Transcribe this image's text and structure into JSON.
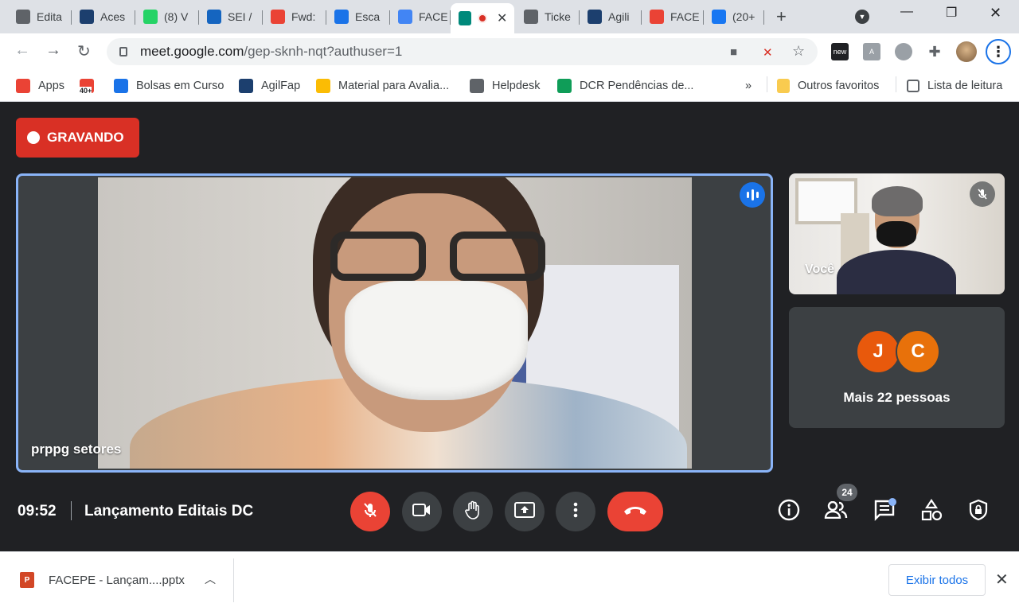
{
  "browser": {
    "tabs": [
      {
        "label": "Edita",
        "icon": "globe-icon",
        "color": "#5f6368"
      },
      {
        "label": "Aces",
        "icon": "app-icon",
        "color": "#1c3f6e"
      },
      {
        "label": "(8) V",
        "icon": "whatsapp-icon",
        "color": "#25d366"
      },
      {
        "label": "SEI /",
        "icon": "sei-icon",
        "color": "#1565c0"
      },
      {
        "label": "Fwd:",
        "icon": "gmail-icon",
        "color": "#ea4335"
      },
      {
        "label": "Esca",
        "icon": "app-icon",
        "color": "#1a73e8"
      },
      {
        "label": "FACE",
        "icon": "calendar-icon",
        "color": "#4285f4"
      },
      {
        "label": "Ticke",
        "icon": "globe-icon",
        "color": "#5f6368"
      },
      {
        "label": "Agili",
        "icon": "agilfap-icon",
        "color": "#1c3f6e"
      },
      {
        "label": "FACE",
        "icon": "app-icon",
        "color": "#ea4335"
      },
      {
        "label": "(20+",
        "icon": "facebook-icon",
        "color": "#1877f2"
      }
    ],
    "active_tab": {
      "icon": "meet-icon",
      "recording": true
    },
    "url_host": "meet.google.com",
    "url_path": "/gep-sknh-nqt?authuser=1",
    "bookmarks": [
      {
        "label": "Apps",
        "icon": "apps-grid-icon",
        "color": "#ea4335"
      },
      {
        "label": "",
        "icon": "gmail-icon",
        "color": "#ea4335",
        "badge": "40+"
      },
      {
        "label": "Bolsas em Curso",
        "icon": "app-icon",
        "color": "#1a73e8"
      },
      {
        "label": "AgilFap",
        "icon": "agilfap-icon",
        "color": "#1c3f6e"
      },
      {
        "label": "Material para Avalia...",
        "icon": "drive-icon",
        "color": "#fbbc04"
      },
      {
        "label": "Helpdesk",
        "icon": "globe-icon",
        "color": "#5f6368"
      },
      {
        "label": "DCR Pendências de...",
        "icon": "sheets-icon",
        "color": "#0f9d58"
      }
    ],
    "overflow": "»",
    "other_bookmarks": "Outros favoritos",
    "reading_list": "Lista de leitura"
  },
  "meet": {
    "recording_label": "GRAVANDO",
    "main_participant": "prppg setores",
    "self_label": "Você",
    "avatars": [
      {
        "initial": "J",
        "color": "#e8590c"
      },
      {
        "initial": "C",
        "color": "#e8710a"
      }
    ],
    "more_people": "Mais 22 pessoas",
    "time": "09:52",
    "meeting_title": "Lançamento Editais DC",
    "participant_count": "24",
    "colors": {
      "end_call": "#ea4335",
      "accent": "#8ab4f8",
      "tile": "#3c4043",
      "background": "#202124"
    }
  },
  "downloads": {
    "file_name": "FACEPE - Lançam....pptx",
    "show_all": "Exibir todos"
  }
}
